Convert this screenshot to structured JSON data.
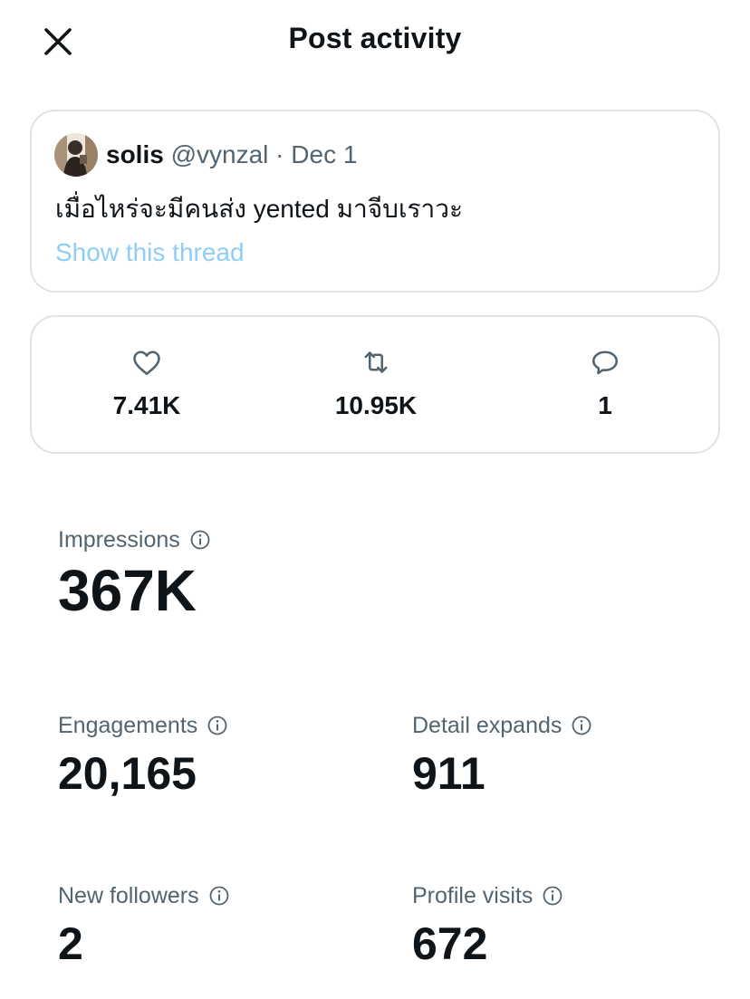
{
  "header": {
    "title": "Post activity"
  },
  "post": {
    "author_name": "solis",
    "author_handle": "@vynzal",
    "separator": "·",
    "date": "Dec 1",
    "text": "เมื่อไหร่จะมีคนส่ง yented มาจีบเราวะ",
    "thread_link": "Show this thread"
  },
  "engagement": {
    "likes": "7.41K",
    "reposts": "10.95K",
    "replies": "1"
  },
  "metrics": {
    "impressions": {
      "label": "Impressions",
      "value": "367K"
    },
    "engagements": {
      "label": "Engagements",
      "value": "20,165"
    },
    "detail_expands": {
      "label": "Detail expands",
      "value": "911"
    },
    "new_followers": {
      "label": "New followers",
      "value": "2"
    },
    "profile_visits": {
      "label": "Profile visits",
      "value": "672"
    }
  },
  "icons": {
    "close": "close-icon",
    "like": "heart-icon",
    "repost": "repost-icon",
    "reply": "reply-bubble-icon",
    "info": "info-icon"
  },
  "colors": {
    "text_primary": "#0f1419",
    "text_secondary": "#536471",
    "link": "#8ecdf5",
    "border": "#dfe3e6"
  }
}
